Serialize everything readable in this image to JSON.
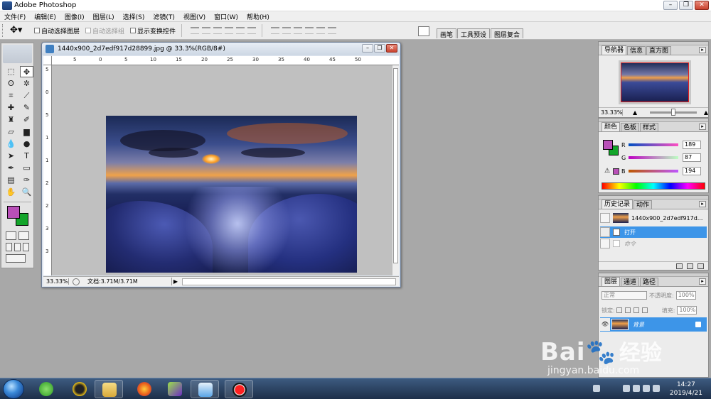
{
  "app": {
    "title": "Adobe Photoshop"
  },
  "window_controls": {
    "minimize": "–",
    "restore": "❐",
    "close": "✕"
  },
  "menu": [
    "文件(F)",
    "编辑(E)",
    "图像(I)",
    "图层(L)",
    "选择(S)",
    "滤镜(T)",
    "视图(V)",
    "窗口(W)",
    "帮助(H)"
  ],
  "options": {
    "auto_select_layer": "自动选择图层",
    "auto_select_group": "自动选择组",
    "show_transform": "显示变换控件"
  },
  "palette_well": {
    "tabs": [
      "画笔",
      "工具预设",
      "图层复合"
    ]
  },
  "document": {
    "title": "1440x900_2d7edf917d28899.jpg @ 33.3%(RGB/8#)",
    "zoom": "33.33%",
    "doc_size": "文档:3.71M/3.71M",
    "ruler_top": [
      "5",
      "0",
      "5",
      "10",
      "15",
      "20",
      "25",
      "30",
      "35",
      "40",
      "45",
      "50"
    ],
    "ruler_left": [
      "5",
      "0",
      "5",
      "1",
      "1",
      "2",
      "2",
      "3",
      "3"
    ]
  },
  "navigator": {
    "tabs": [
      "导航器",
      "信息",
      "直方图"
    ],
    "zoom": "33.33%"
  },
  "color_panel": {
    "tabs": [
      "颜色",
      "色板",
      "样式"
    ],
    "fg_color": "#b94fb8",
    "bg_color": "#13a52a",
    "r_label": "R",
    "g_label": "G",
    "b_label": "B",
    "r": "189",
    "g": "87",
    "b": "194"
  },
  "history": {
    "tabs": [
      "历史记录",
      "动作"
    ],
    "snapshot": "1440x900_2d7edf917d...",
    "items": [
      "打开",
      "命令"
    ]
  },
  "layers": {
    "tabs": [
      "图层",
      "通道",
      "路径"
    ],
    "blend_mode": "正常",
    "opacity_label": "不透明度:",
    "opacity": "100%",
    "lock_label": "锁定:",
    "fill_label": "填充:",
    "fill": "100%",
    "layer_name": "背景"
  },
  "taskbar": {
    "time": "14:27",
    "date": "2019/4/21"
  },
  "watermark": {
    "brand": "Bai",
    "cn": "经验",
    "url": "jingyan.baidu.com"
  }
}
